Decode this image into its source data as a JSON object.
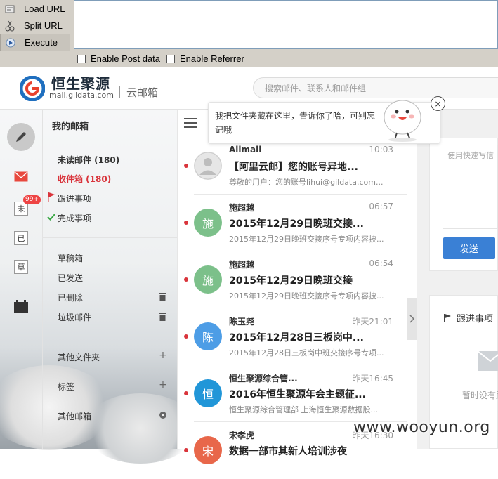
{
  "hackbar": {
    "load_url": "Load URL",
    "split_url": "Split URL",
    "execute": "Execute",
    "enable_post": "Enable Post data",
    "enable_referrer": "Enable Referrer"
  },
  "header": {
    "logo_title": "恒生聚源",
    "logo_domain": "mail.gildata.com",
    "product": "云邮箱",
    "search_placeholder": "搜索邮件、联系人和邮件组"
  },
  "rail": {
    "badge": "99+",
    "unread": "未",
    "read": "已",
    "draft": "草"
  },
  "folders": {
    "title": "我的邮箱",
    "unread": "未读邮件 (180)",
    "inbox": "收件箱 (180)",
    "follow": "跟进事项",
    "done": "完成事项",
    "drafts": "草稿箱",
    "sent": "已发送",
    "deleted": "已删除",
    "junk": "垃圾邮件",
    "other_folders": "其他文件夹",
    "tags": "标签",
    "other_mail": "其他邮箱"
  },
  "tooltip": {
    "text": "我把文件夹藏在这里，告诉你了哈，可别忘记哦",
    "close": "×"
  },
  "mails": [
    {
      "from": "Alimail",
      "time": "10:03",
      "subject": "【阿里云邮】您的账号异地...",
      "preview": "尊敬的用户：您的账号lihui@gildata.com...",
      "avatar": "",
      "avatar_color": "#d5d5d5"
    },
    {
      "from": "施超越",
      "time": "06:57",
      "subject": "2015年12月29日晚班交接...",
      "preview": "2015年12月29日晚班交接序号专项内容披...",
      "avatar": "施",
      "avatar_color": "#7cc08a"
    },
    {
      "from": "施超越",
      "time": "06:54",
      "subject": "2015年12月29日晚班交接",
      "preview": "2015年12月29日晚班交接序号专项内容披...",
      "avatar": "施",
      "avatar_color": "#7cc08a"
    },
    {
      "from": "陈玉尧",
      "time": "昨天21:01",
      "subject": "2015年12月28日三板岗中...",
      "preview": "2015年12月28日三板岗中班交接序号专项...",
      "avatar": "陈",
      "avatar_color": "#4d9de6"
    },
    {
      "from": "恒生聚源综合管...",
      "time": "昨天16:45",
      "subject": "2016年恒生聚源年会主题征...",
      "preview": "恒生聚源综合管理部 上海恒生聚源数据股...",
      "avatar": "恒",
      "avatar_color": "#2196d8"
    },
    {
      "from": "宋孝虎",
      "time": "昨天16:30",
      "subject": "数据一部市其新人培训涉夜",
      "preview": "",
      "avatar": "宋",
      "avatar_color": "#e8674a"
    }
  ],
  "right": {
    "quick_placeholder": "使用快速写信",
    "send": "发送",
    "follow_title": "跟进事项",
    "empty": "暂时没有跟进"
  },
  "watermark": "www.wooyun.org"
}
